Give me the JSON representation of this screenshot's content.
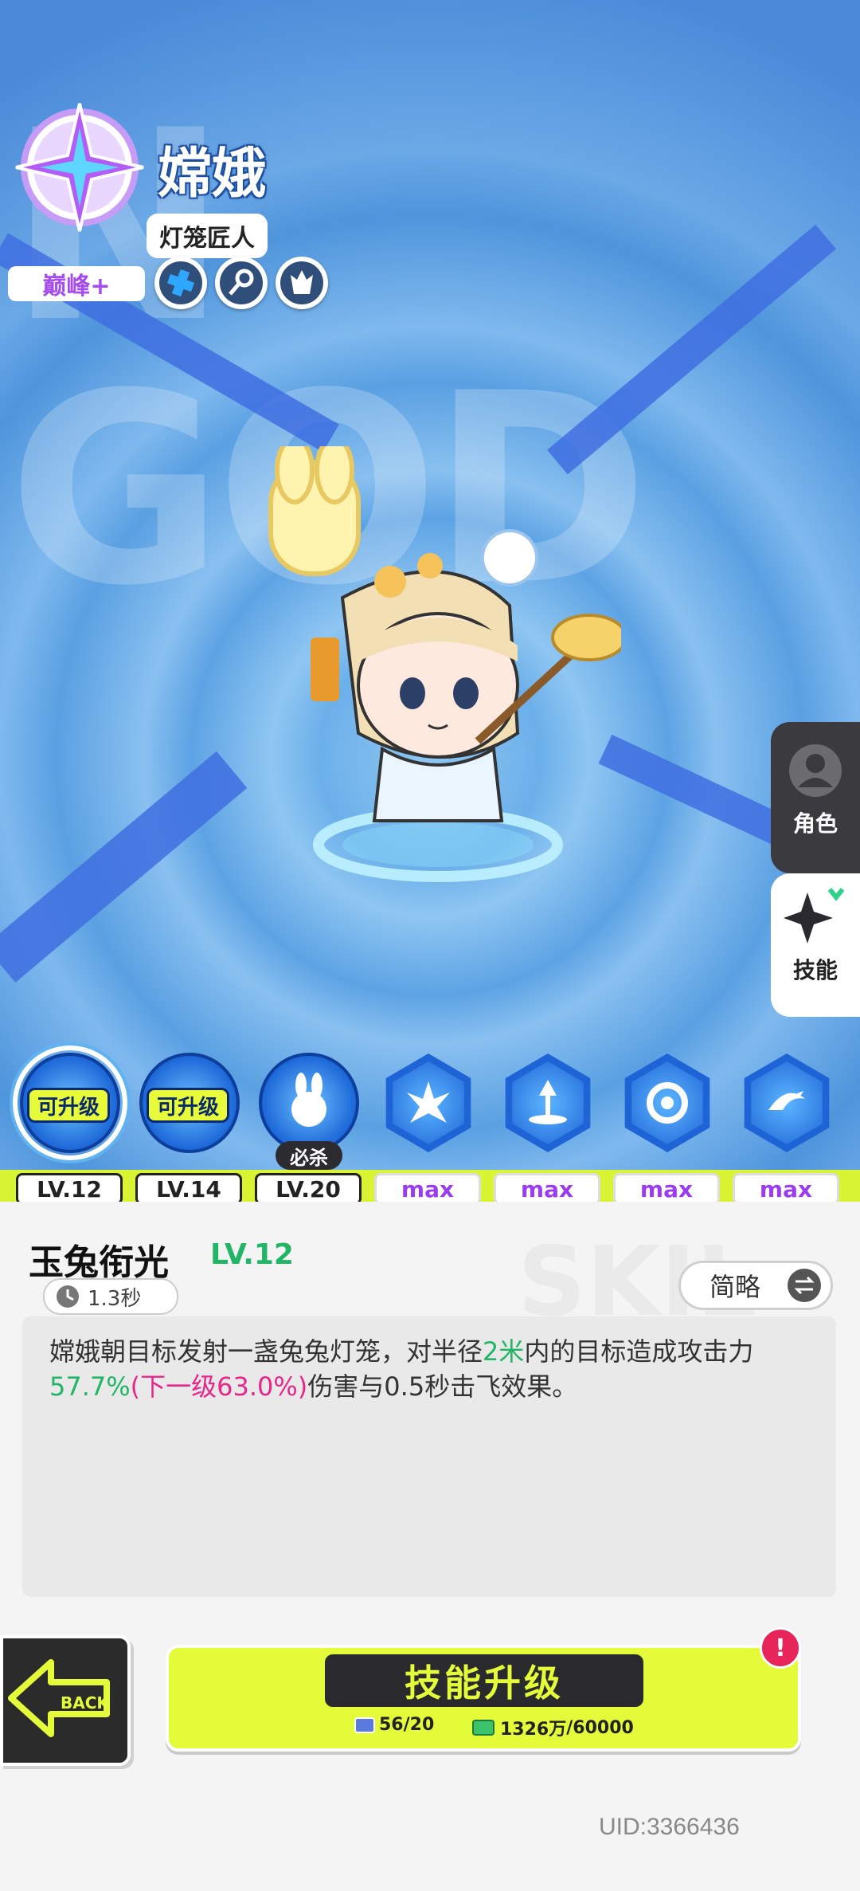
{
  "character": {
    "watermark": "N GOD",
    "name": "嫦娥",
    "title": "灯笼匠人",
    "rank": "巅峰+",
    "trait_icons": [
      "cross-icon",
      "key-icon",
      "flame-icon"
    ]
  },
  "side_tabs": {
    "role_label": "角色",
    "skill_label": "技能"
  },
  "skills": [
    {
      "icon": "lantern-wave-icon",
      "badge": "可升级",
      "level": "LV.12"
    },
    {
      "icon": "cloud-icon",
      "badge": "可升级",
      "level": "LV.14"
    },
    {
      "icon": "rabbit-icon",
      "badge": "必杀",
      "level": "LV.20"
    },
    {
      "icon": "burst-icon",
      "level": "max"
    },
    {
      "icon": "fountain-icon",
      "level": "max"
    },
    {
      "icon": "vortex-icon",
      "level": "max"
    },
    {
      "icon": "swirl-icon",
      "level": "max"
    }
  ],
  "detail": {
    "watermark": "SKIL",
    "skill_name": "玉兔衔光",
    "skill_level": "LV.12",
    "cooldown": "1.3秒",
    "brief_label": "简略",
    "desc_1": "嫦娥朝目标发射一盏兔兔灯笼，对半径",
    "desc_radius": "2米",
    "desc_2": "内的目标造成攻击力",
    "desc_pct": "57.7%",
    "desc_next": "(下一级63.0%)",
    "desc_3": "伤害与0.5秒击飞效果。"
  },
  "footer": {
    "back_label": "BACK",
    "upgrade_label": "技能升级",
    "books": "56/20",
    "gold_amount": "1326万",
    "gold_required": "/60000",
    "alert": "!",
    "uid": "UID:3366436"
  },
  "colors": {
    "accent_yellow": "#e4fb3a",
    "level_green": "#22b566",
    "next_pink": "#e8258a",
    "max_purple": "#9b3cf0"
  }
}
